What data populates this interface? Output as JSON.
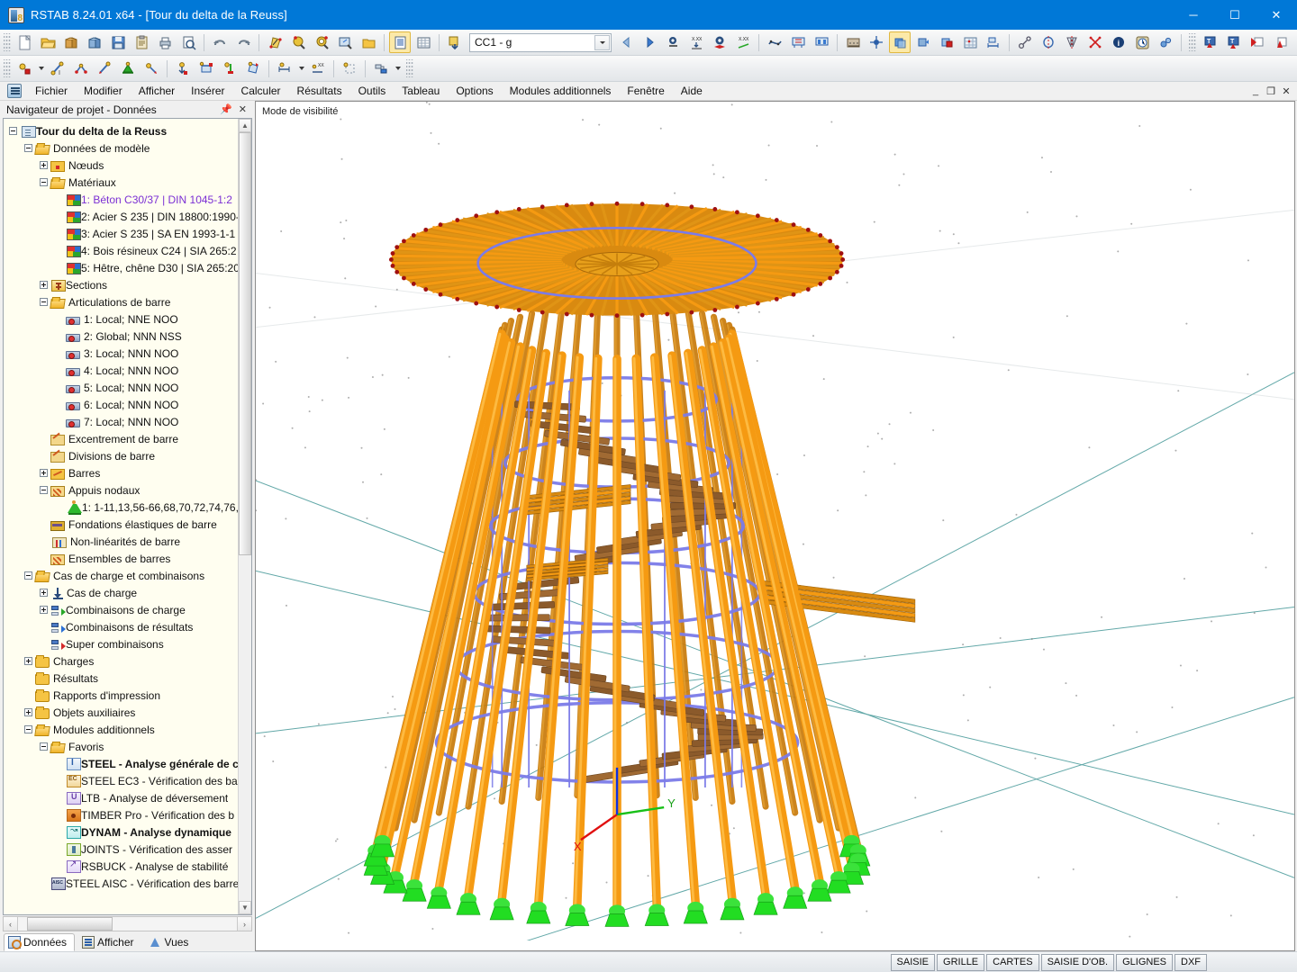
{
  "window": {
    "title": "RSTAB 8.24.01 x64 - [Tour du delta de la Reuss]",
    "minimize": "─",
    "maximize": "☐",
    "close": "✕",
    "app_icon": "rstab-icon"
  },
  "mdi": {
    "minimize": "_",
    "restore": "❐",
    "close": "✕"
  },
  "menu": {
    "items": [
      {
        "label": "Fichier"
      },
      {
        "label": "Modifier"
      },
      {
        "label": "Afficher"
      },
      {
        "label": "Insérer"
      },
      {
        "label": "Calculer"
      },
      {
        "label": "Résultats"
      },
      {
        "label": "Outils"
      },
      {
        "label": "Tableau"
      },
      {
        "label": "Options"
      },
      {
        "label": "Modules additionnels"
      },
      {
        "label": "Fenêtre"
      },
      {
        "label": "Aide"
      }
    ]
  },
  "toolbar": {
    "load_case_combo": "CC1 - g",
    "row1": [
      "new-document-icon",
      "open-folder-icon",
      "open-model-icon",
      "save-as-model-icon",
      "save-icon",
      "clipboard-icon",
      "print-icon",
      "print-preview-icon",
      "undo-icon",
      "redo-icon",
      "render-surface-icon",
      "zoom-in-icon",
      "zoom-out-icon",
      "zoom-window-icon",
      "restore-view-icon",
      "show-tables-icon",
      "show-grid-table-icon",
      "new-load-case-icon"
    ],
    "row1b": [
      "previous-load-case-icon",
      "next-load-case-icon",
      "results-icon",
      "min-values-icon",
      "results-view-icon",
      "max-values-icon",
      "deformation-icon",
      "support-forces-icon",
      "member-forces-icon",
      "numbering-icon",
      "grid-snap-icon",
      "wireframe-icon",
      "solid-model-icon",
      "section-render-icon",
      "mesh-icon",
      "measure-icon",
      "node-connect-icon",
      "rotate-icon",
      "mirror-icon",
      "cross-select-icon",
      "info-icon",
      "clock-icon",
      "settings-icon",
      "export-view-icon",
      "export-image-icon",
      "pin-view-icon",
      "pin-drop-icon"
    ],
    "row2": [
      "new-node-icon",
      "new-member-icon",
      "new-member-set-icon",
      "edit-member-icon",
      "new-support-icon",
      "new-hinge-icon",
      "nodal-load-icon",
      "member-load-icon",
      "free-load-icon",
      "surface-load-icon",
      "dimension-icon",
      "dimension-auto-icon",
      "guide-object-icon",
      "object-snap-icon"
    ]
  },
  "navigator": {
    "title": "Navigateur de projet - Données",
    "pin_icon": "pin-icon",
    "close_icon": "close-icon",
    "tree": [
      {
        "label": "Tour du delta de la Reuss",
        "depth": 0,
        "toggle": "minus",
        "icon": "doc",
        "bold": true
      },
      {
        "label": "Données de modèle",
        "depth": 1,
        "toggle": "minus",
        "icon": "folder-open"
      },
      {
        "label": "Nœuds",
        "depth": 2,
        "toggle": "plus",
        "icon": "noeud"
      },
      {
        "label": "Matériaux",
        "depth": 2,
        "toggle": "minus",
        "icon": "folder-open"
      },
      {
        "label": "1: Béton C30/37 | DIN 1045-1:2",
        "depth": 3,
        "toggle": "none",
        "icon": "mat",
        "selected": true
      },
      {
        "label": "2: Acier S 235 | DIN 18800:1990-",
        "depth": 3,
        "toggle": "none",
        "icon": "mat"
      },
      {
        "label": "3: Acier S 235 | SA EN 1993-1-1",
        "depth": 3,
        "toggle": "none",
        "icon": "mat"
      },
      {
        "label": "4: Bois résineux C24 | SIA 265:2",
        "depth": 3,
        "toggle": "none",
        "icon": "mat"
      },
      {
        "label": "5: Hêtre, chêne D30 | SIA 265:20",
        "depth": 3,
        "toggle": "none",
        "icon": "mat"
      },
      {
        "label": "Sections",
        "depth": 2,
        "toggle": "plus",
        "icon": "sections"
      },
      {
        "label": "Articulations de barre",
        "depth": 2,
        "toggle": "minus",
        "icon": "folder-open"
      },
      {
        "label": "1: Local; NNE NOO",
        "depth": 3,
        "toggle": "none",
        "icon": "hinge"
      },
      {
        "label": "2: Global; NNN NSS",
        "depth": 3,
        "toggle": "none",
        "icon": "hinge"
      },
      {
        "label": "3: Local; NNN NOO",
        "depth": 3,
        "toggle": "none",
        "icon": "hinge"
      },
      {
        "label": "4: Local; NNN NOO",
        "depth": 3,
        "toggle": "none",
        "icon": "hinge"
      },
      {
        "label": "5: Local; NNN NOO",
        "depth": 3,
        "toggle": "none",
        "icon": "hinge"
      },
      {
        "label": "6: Local; NNN NOO",
        "depth": 3,
        "toggle": "none",
        "icon": "hinge"
      },
      {
        "label": "7: Local; NNN NOO",
        "depth": 3,
        "toggle": "none",
        "icon": "hinge"
      },
      {
        "label": "Excentrement de barre",
        "depth": 2,
        "toggle": "none",
        "icon": "pencil"
      },
      {
        "label": "Divisions de barre",
        "depth": 2,
        "toggle": "none",
        "icon": "pencil"
      },
      {
        "label": "Barres",
        "depth": 2,
        "toggle": "plus",
        "icon": "barres"
      },
      {
        "label": "Appuis nodaux",
        "depth": 2,
        "toggle": "minus",
        "icon": "ens"
      },
      {
        "label": "1: 1-11,13,56-66,68,70,72,74,76,",
        "depth": 3,
        "toggle": "none",
        "icon": "support"
      },
      {
        "label": "Fondations élastiques de barre",
        "depth": 2,
        "toggle": "none",
        "icon": "fond"
      },
      {
        "label": "Non-linéarités de barre",
        "depth": 2,
        "toggle": "none",
        "icon": "nonlin"
      },
      {
        "label": "Ensembles de barres",
        "depth": 2,
        "toggle": "none",
        "icon": "ens"
      },
      {
        "label": "Cas de charge et combinaisons",
        "depth": 1,
        "toggle": "minus",
        "icon": "folder-open"
      },
      {
        "label": "Cas de charge",
        "depth": 2,
        "toggle": "plus",
        "icon": "arrowdn"
      },
      {
        "label": "Combinaisons de charge",
        "depth": 2,
        "toggle": "plus",
        "icon": "combo-green"
      },
      {
        "label": "Combinaisons de résultats",
        "depth": 2,
        "toggle": "none",
        "icon": "combo-blue"
      },
      {
        "label": "Super combinaisons",
        "depth": 2,
        "toggle": "none",
        "icon": "combo-red"
      },
      {
        "label": "Charges",
        "depth": 1,
        "toggle": "plus",
        "icon": "folder"
      },
      {
        "label": "Résultats",
        "depth": 1,
        "toggle": "none",
        "icon": "folder"
      },
      {
        "label": "Rapports d'impression",
        "depth": 1,
        "toggle": "none",
        "icon": "folder"
      },
      {
        "label": "Objets auxiliaires",
        "depth": 1,
        "toggle": "plus",
        "icon": "folder"
      },
      {
        "label": "Modules additionnels",
        "depth": 1,
        "toggle": "minus",
        "icon": "folder-open"
      },
      {
        "label": "Favoris",
        "depth": 2,
        "toggle": "minus",
        "icon": "folder-open"
      },
      {
        "label": "STEEL - Analyse générale de c",
        "depth": 3,
        "toggle": "none",
        "icon": "mod-steel",
        "bold": true
      },
      {
        "label": "STEEL EC3 - Vérification des ba",
        "depth": 3,
        "toggle": "none",
        "icon": "mod-ec3"
      },
      {
        "label": "LTB - Analyse de déversement",
        "depth": 3,
        "toggle": "none",
        "icon": "mod-ltb"
      },
      {
        "label": "TIMBER Pro - Vérification des b",
        "depth": 3,
        "toggle": "none",
        "icon": "mod-timber"
      },
      {
        "label": "DYNAM - Analyse dynamique",
        "depth": 3,
        "toggle": "none",
        "icon": "mod-dynam",
        "bold": true
      },
      {
        "label": "JOINTS - Vérification des asser",
        "depth": 3,
        "toggle": "none",
        "icon": "mod-joints"
      },
      {
        "label": "RSBUCK - Analyse de stabilité",
        "depth": 3,
        "toggle": "none",
        "icon": "mod-rsbuck"
      },
      {
        "label": "STEEL AISC - Vérification des barre",
        "depth": 2,
        "toggle": "none",
        "icon": "mod-aisc"
      }
    ],
    "scroll_up": "▲",
    "scroll_down": "▼",
    "scroll_left": "‹",
    "scroll_right": "›",
    "tabs": [
      {
        "label": "Données",
        "icon": "data-icon",
        "active": true
      },
      {
        "label": "Afficher",
        "icon": "display-icon",
        "active": false
      },
      {
        "label": "Vues",
        "icon": "views-icon",
        "active": false
      }
    ]
  },
  "viewport": {
    "label": "Mode de visibilité",
    "model_name": "Tour du delta de la Reuss",
    "axis_x": "X",
    "axis_y": "Y",
    "colors": {
      "member_orange": "#F59A12",
      "member_orange_dark": "#C87A0A",
      "member_brown": "#8B5A2B",
      "support_green": "#22DD22",
      "rail_blue": "#7B7BE8",
      "node_red": "#A01010",
      "grid_teal": "#2E8B8B",
      "background": "#FFFFFF"
    }
  },
  "statusbar": {
    "buttons": [
      {
        "label": "SAISIE"
      },
      {
        "label": "GRILLE"
      },
      {
        "label": "CARTES"
      },
      {
        "label": "SAISIE D'OB."
      },
      {
        "label": "GLIGNES"
      },
      {
        "label": "DXF"
      }
    ]
  }
}
